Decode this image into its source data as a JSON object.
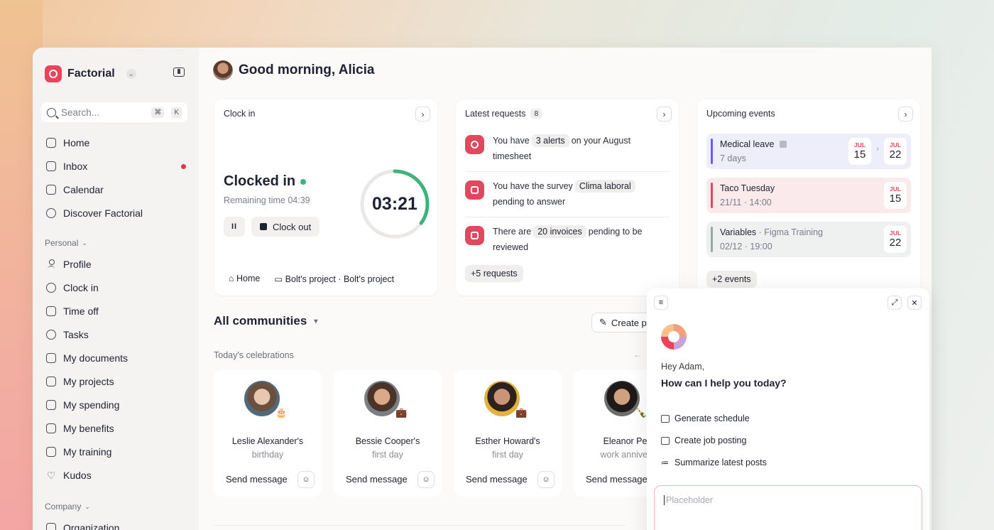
{
  "sidebar": {
    "brand": "Factorial",
    "search": {
      "placeholder": "Search...",
      "kbd1": "⌘",
      "kbd2": "K"
    },
    "main_items": [
      {
        "label": "Home"
      },
      {
        "label": "Inbox"
      },
      {
        "label": "Calendar"
      },
      {
        "label": "Discover Factorial"
      }
    ],
    "personal_label": "Personal",
    "personal_items": [
      {
        "label": "Profile"
      },
      {
        "label": "Clock in"
      },
      {
        "label": "Time off"
      },
      {
        "label": "Tasks"
      },
      {
        "label": "My documents"
      },
      {
        "label": "My projects"
      },
      {
        "label": "My spending"
      },
      {
        "label": "My benefits"
      },
      {
        "label": "My training"
      },
      {
        "label": "Kudos"
      }
    ],
    "company_label": "Company",
    "company_items": [
      {
        "label": "Organization"
      }
    ]
  },
  "header": {
    "greeting": "Good morning, Alicia"
  },
  "clock": {
    "title": "Clock in",
    "status": "Clocked in",
    "remaining": "Remaining time 04:39",
    "pause_label": "II",
    "clockout_label": "Clock out",
    "timer": "03:21",
    "progress": 0.35,
    "foot_home": "Home",
    "foot_project": "Bolt's project · Bolt's project"
  },
  "requests": {
    "title": "Latest requests",
    "count": "8",
    "items": [
      {
        "pre": "You have",
        "chip": "3 alerts",
        "post": "on your August",
        "line2": "timesheet"
      },
      {
        "pre": "You have the survey",
        "chip": "Clima laboral",
        "post": "",
        "line2": "pending to answer"
      },
      {
        "pre": "There are",
        "chip": "20 invoices",
        "post": "pending to be",
        "line2": "reviewed"
      }
    ],
    "more": "+5 requests"
  },
  "events": {
    "title": "Upcoming events",
    "items": [
      {
        "name": "Medical leave",
        "sub": "7 days",
        "mon1": "JUL",
        "day1": "15",
        "mon2": "JUL",
        "day2": "22"
      },
      {
        "name": "Taco Tuesday",
        "sub": "21/11 · 14:00",
        "mon": "JUL",
        "day": "15"
      },
      {
        "name": "Variables",
        "extra": "· Figma Training",
        "sub": "02/12 · 19:00",
        "mon": "JUL",
        "day": "22"
      }
    ],
    "more": "+2 events"
  },
  "communities": {
    "title": "All communities",
    "create_label": "Create p",
    "celebrations_label": "Today's celebrations",
    "cards": [
      {
        "name": "Leslie Alexander's",
        "sub": "birthday",
        "send": "Send message",
        "badge": "🎂"
      },
      {
        "name": "Bessie Cooper's",
        "sub": "first day",
        "send": "Send message",
        "badge": "💼"
      },
      {
        "name": "Esther Howard's",
        "sub": "first day",
        "send": "Send message",
        "badge": "💼"
      },
      {
        "name": "Eleanor Pen",
        "sub": "work annivers",
        "send": "Send message",
        "badge": "🍾"
      }
    ]
  },
  "assistant": {
    "hey": "Hey Adam,",
    "question": "How can I help you today?",
    "options": [
      {
        "label": "Generate schedule"
      },
      {
        "label": "Create job posting"
      },
      {
        "label": "Summarize latest posts"
      }
    ],
    "placeholder": "Placeholder"
  },
  "colors": {
    "accent": "#e8455c",
    "green": "#3fb37a",
    "purple_bar": "#6a5cf0"
  }
}
